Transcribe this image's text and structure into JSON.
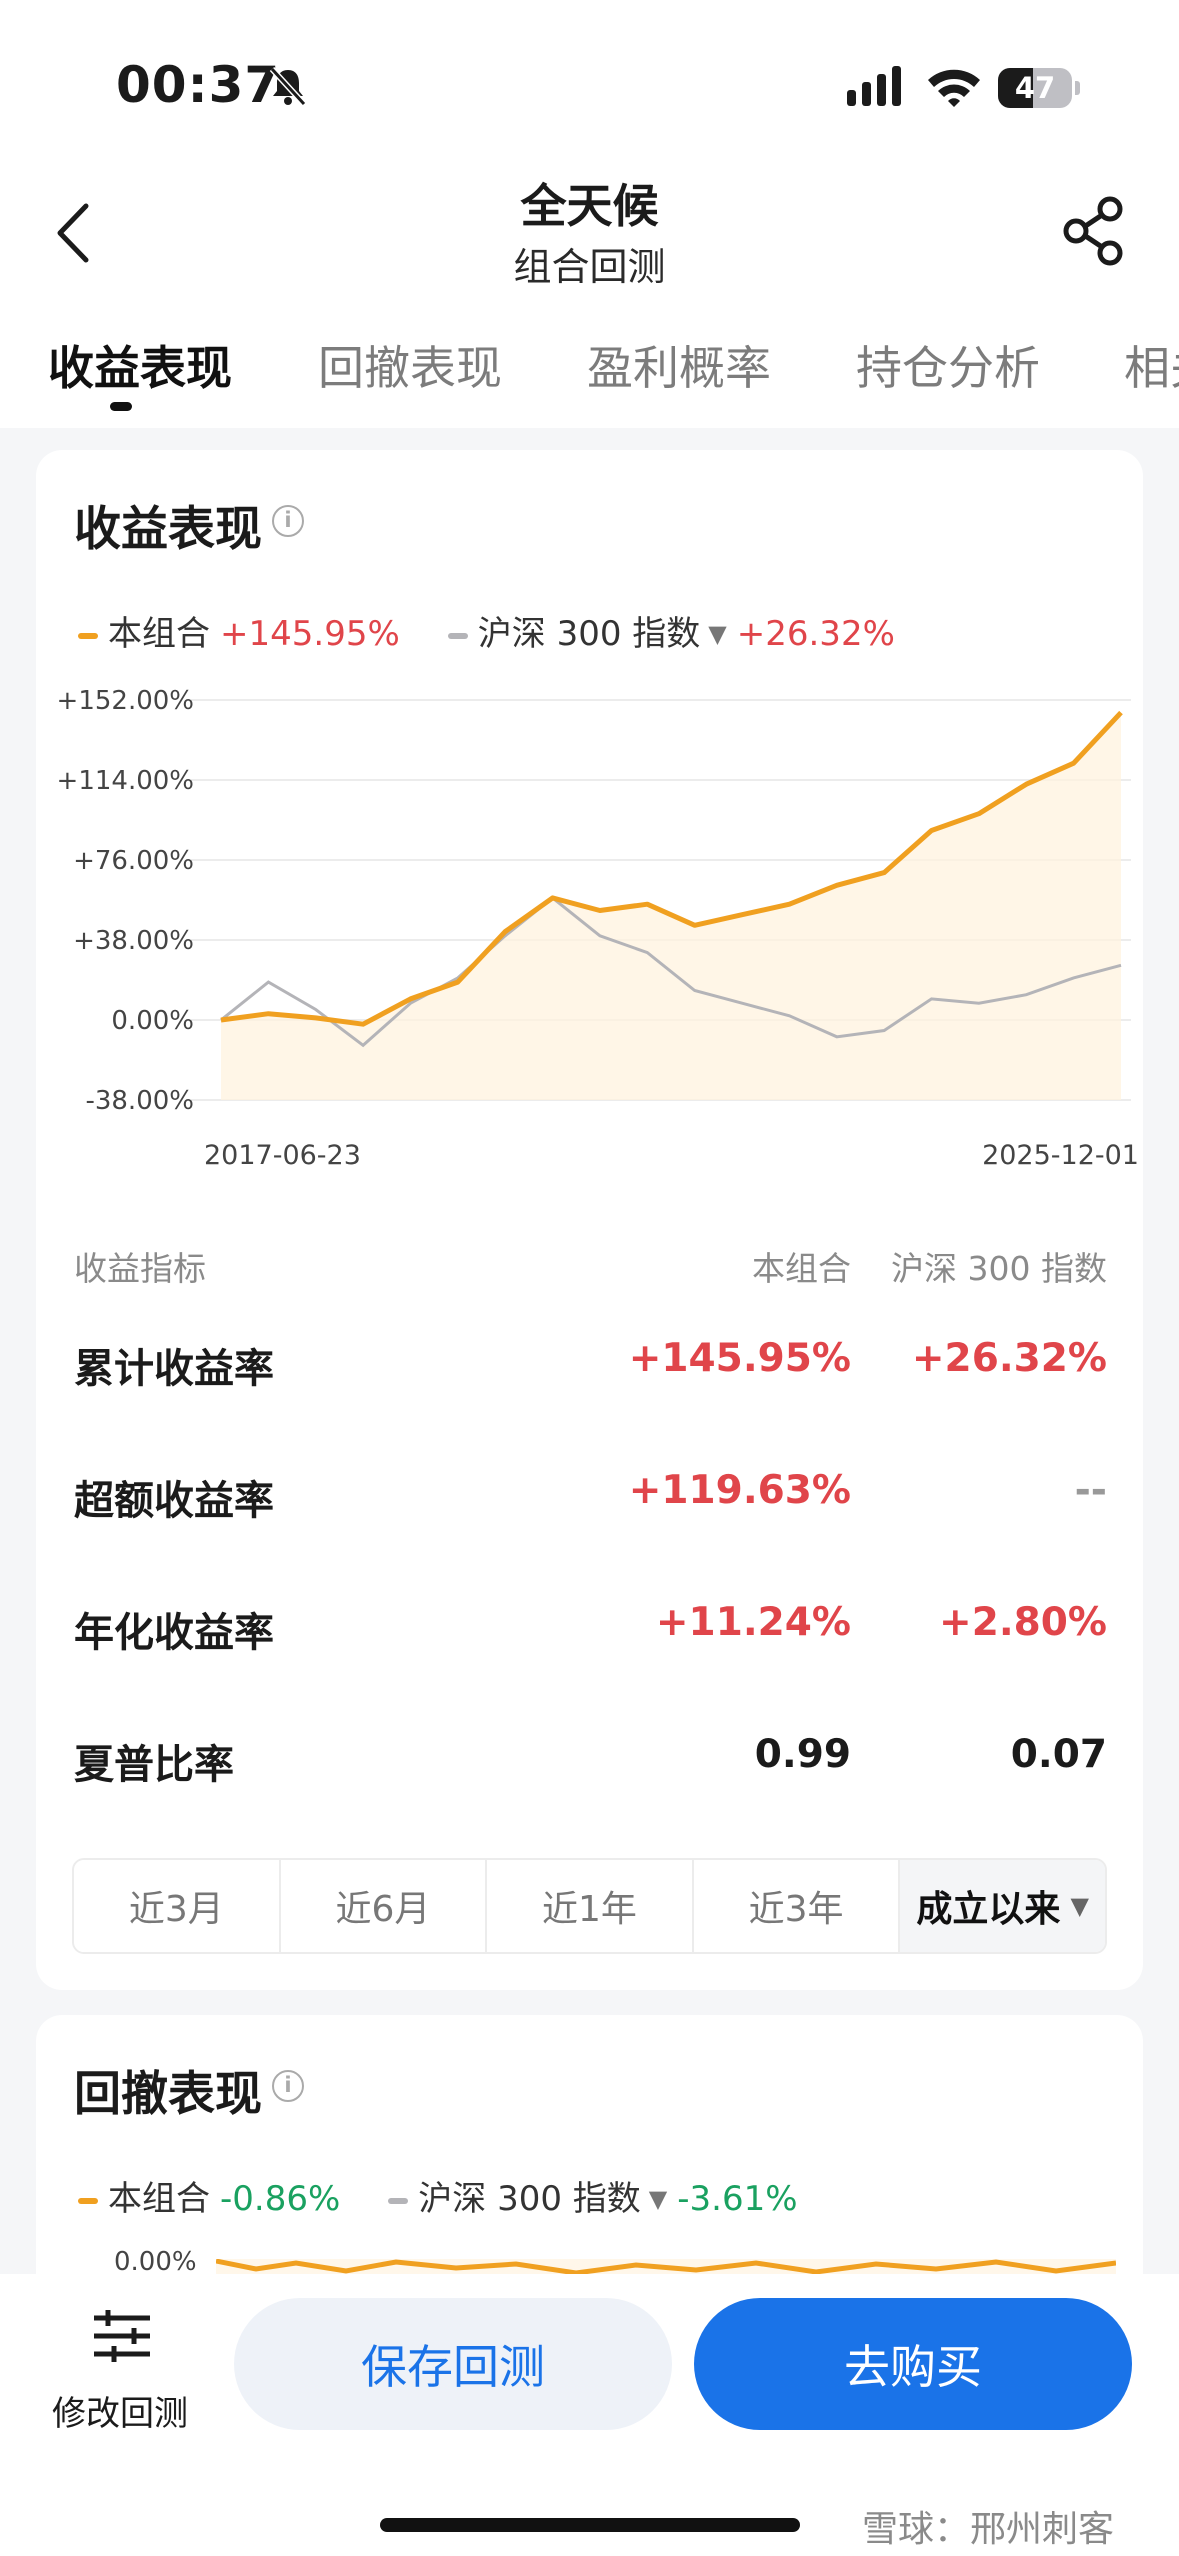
{
  "status_bar": {
    "time": "00:37",
    "battery": "47",
    "battery_level": 0.47
  },
  "nav": {
    "title": "全天候",
    "subtitle": "组合回测"
  },
  "tabs": [
    {
      "label": "收益表现"
    },
    {
      "label": "回撤表现"
    },
    {
      "label": "盈利概率"
    },
    {
      "label": "持仓分析"
    },
    {
      "label": "相关"
    }
  ],
  "returns_card": {
    "title": "收益表现",
    "info_glyph": "i",
    "legend": {
      "portfolio_name": "本组合",
      "portfolio_value": "+145.95%",
      "benchmark_name": "沪深 300 指数",
      "benchmark_value": "+26.32%"
    },
    "metrics_header": {
      "label": "收益指标",
      "col_a": "本组合",
      "col_b": "沪深 300 指数"
    },
    "metrics": [
      {
        "label": "累计收益率",
        "a": "+145.95%",
        "b": "+26.32%"
      },
      {
        "label": "超额收益率",
        "a": "+119.63%",
        "b": "--"
      },
      {
        "label": "年化收益率",
        "a": "+11.24%",
        "b": "+2.80%"
      },
      {
        "label": "夏普比率",
        "a": "0.99",
        "b": "0.07"
      }
    ],
    "periods": [
      "近3月",
      "近6月",
      "近1年",
      "近3年",
      "成立以来"
    ],
    "selected_period": "成立以来"
  },
  "drawdown_card": {
    "title": "回撤表现",
    "info_glyph": "i",
    "legend": {
      "portfolio_name": "本组合",
      "portfolio_value": "-0.86%",
      "benchmark_name": "沪深 300 指数",
      "benchmark_value": "-3.61%"
    },
    "y_top_label": "0.00%"
  },
  "bottom": {
    "edit_label": "修改回测",
    "save_label": "保存回测",
    "buy_label": "去购买"
  },
  "watermark": "雪球：邢州刺客",
  "colors": {
    "portfolio": "#f0a020",
    "benchmark": "#b4b4b8",
    "up": "#e0454a",
    "down": "#1aa160",
    "accent": "#1a73e8"
  },
  "chart_data": {
    "type": "line",
    "x_start": "2017-06-23",
    "x_end": "2025-12-01",
    "x_tick_labels": [
      "2017-06-23",
      "2025-12-01"
    ],
    "y_ticks": [
      152,
      114,
      76,
      38,
      0,
      -38
    ],
    "y_tick_labels": [
      "+152.00%",
      "+114.00%",
      "+76.00%",
      "+38.00%",
      "0.00%",
      "-38.00%"
    ],
    "ylim": [
      -38,
      152
    ],
    "grid": true,
    "x": [
      "2017-06",
      "2017-12",
      "2018-06",
      "2018-12",
      "2019-06",
      "2019-12",
      "2020-06",
      "2020-12",
      "2021-06",
      "2021-12",
      "2022-06",
      "2022-12",
      "2023-06",
      "2023-12",
      "2024-06",
      "2024-12",
      "2025-03",
      "2025-06",
      "2025-09",
      "2025-12"
    ],
    "series": [
      {
        "name": "本组合",
        "values": [
          0,
          3,
          1,
          -2,
          10,
          18,
          42,
          58,
          52,
          55,
          45,
          50,
          55,
          64,
          70,
          90,
          98,
          112,
          122,
          146
        ]
      },
      {
        "name": "沪深 300 指数",
        "values": [
          0,
          18,
          5,
          -12,
          8,
          20,
          40,
          58,
          40,
          32,
          14,
          8,
          2,
          -8,
          -5,
          10,
          8,
          12,
          20,
          26
        ]
      }
    ]
  }
}
